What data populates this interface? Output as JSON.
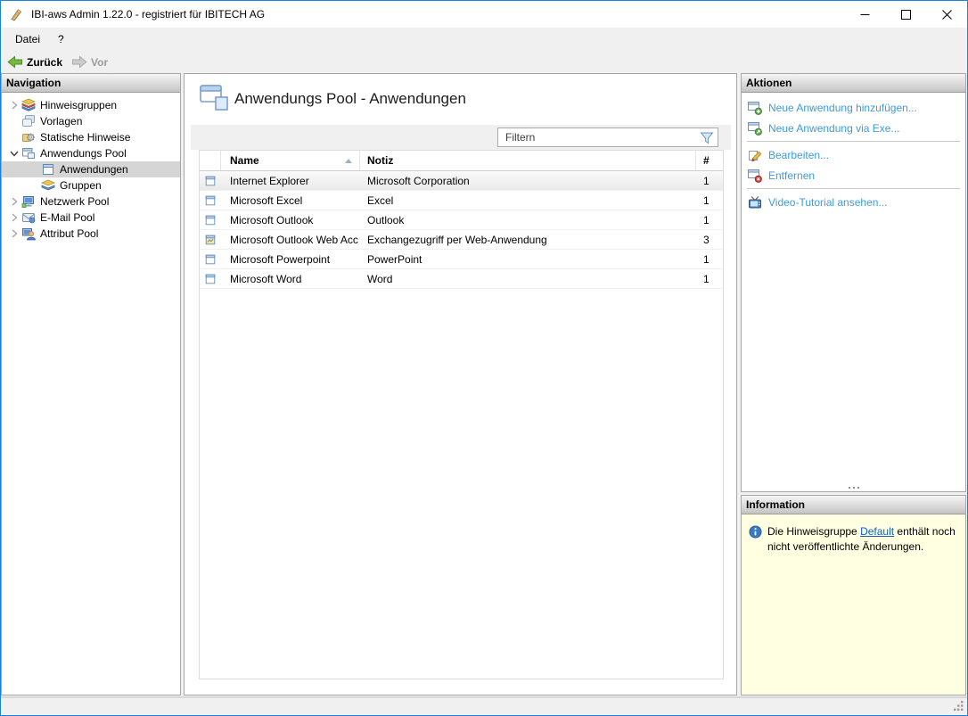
{
  "window": {
    "title": "IBI-aws Admin 1.22.0 - registriert für IBITECH AG"
  },
  "menu": {
    "items": [
      {
        "label": "Datei"
      },
      {
        "label": "?"
      }
    ]
  },
  "toolbar": {
    "back_label": "Zurück",
    "forward_label": "Vor"
  },
  "navigation": {
    "header": "Navigation",
    "items": [
      {
        "label": "Hinweisgruppen",
        "icon": "notice-groups-icon",
        "expander": "collapsed",
        "level": 0,
        "selected": false
      },
      {
        "label": "Vorlagen",
        "icon": "templates-icon",
        "expander": "none",
        "level": 0,
        "selected": false
      },
      {
        "label": "Statische Hinweise",
        "icon": "static-notices-icon",
        "expander": "none",
        "level": 0,
        "selected": false
      },
      {
        "label": "Anwendungs Pool",
        "icon": "application-pool-icon",
        "expander": "expanded",
        "level": 0,
        "selected": false
      },
      {
        "label": "Anwendungen",
        "icon": "application-icon",
        "expander": "none",
        "level": 1,
        "selected": true
      },
      {
        "label": "Gruppen",
        "icon": "groups-icon",
        "expander": "none",
        "level": 1,
        "selected": false
      },
      {
        "label": "Netzwerk Pool",
        "icon": "network-pool-icon",
        "expander": "collapsed",
        "level": 0,
        "selected": false
      },
      {
        "label": "E-Mail Pool",
        "icon": "email-pool-icon",
        "expander": "collapsed",
        "level": 0,
        "selected": false
      },
      {
        "label": "Attribut Pool",
        "icon": "attribute-pool-icon",
        "expander": "collapsed",
        "level": 0,
        "selected": false
      }
    ]
  },
  "main": {
    "title": "Anwendungs Pool - Anwendungen",
    "filter_placeholder": "Filtern",
    "table": {
      "columns": [
        {
          "label": "Name",
          "sorted": "asc"
        },
        {
          "label": "Notiz",
          "sorted": "none"
        },
        {
          "label": "#",
          "sorted": "none"
        }
      ],
      "rows": [
        {
          "name": "Internet Explorer",
          "notiz": "Microsoft Corporation",
          "count": "1",
          "icon": "application-icon",
          "highlighted": true
        },
        {
          "name": "Microsoft Excel",
          "notiz": "Excel",
          "count": "1",
          "icon": "application-icon",
          "highlighted": false
        },
        {
          "name": "Microsoft Outlook",
          "notiz": "Outlook",
          "count": "1",
          "icon": "application-icon",
          "highlighted": false
        },
        {
          "name": "Microsoft Outlook Web Acc",
          "notiz": "Exchangezugriff per Web-Anwendung",
          "count": "3",
          "icon": "web-application-icon",
          "highlighted": false
        },
        {
          "name": "Microsoft Powerpoint",
          "notiz": "PowerPoint",
          "count": "1",
          "icon": "application-icon",
          "highlighted": false
        },
        {
          "name": "Microsoft Word",
          "notiz": "Word",
          "count": "1",
          "icon": "application-icon",
          "highlighted": false
        }
      ]
    }
  },
  "actions": {
    "header": "Aktionen",
    "items": [
      {
        "label": "Neue Anwendung hinzufügen...",
        "icon": "add-application-icon"
      },
      {
        "label": "Neue Anwendung via Exe...",
        "icon": "add-application-exe-icon"
      },
      {
        "label": "Bearbeiten...",
        "icon": "edit-icon"
      },
      {
        "label": "Entfernen",
        "icon": "remove-icon"
      },
      {
        "label": "Video-Tutorial ansehen...",
        "icon": "video-tutorial-icon"
      }
    ]
  },
  "information": {
    "header": "Information",
    "message_before": "Die Hinweisgruppe ",
    "link_text": "Default",
    "message_after": " enthält noch nicht veröffentlichte Änderungen."
  },
  "icons": {
    "app-icon": "gold-hand-tool",
    "back-icon": "green-left-arrow",
    "forward-icon": "gray-right-arrow",
    "filter-funnel-icon": "blue-funnel",
    "sort-asc-icon": "up-triangle",
    "info-icon": "blue-circle-i",
    "minimize-icon": "–",
    "maximize-icon": "□",
    "close-icon": "✕"
  },
  "colors": {
    "window_border": "#1883d7",
    "chrome_bg": "#f0f0f0",
    "link_blue": "#3f9ade",
    "hyperlink_blue": "#0b61c2",
    "info_bg": "#ffffe1",
    "selection_gray": "#d5d5d5",
    "back_arrow_green": "#76b944"
  }
}
